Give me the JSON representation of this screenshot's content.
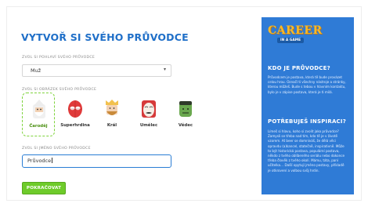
{
  "page": {
    "title": "Vytvoř si svého průvodce"
  },
  "gender": {
    "label": "ZVOL SI POHLAVÍ SVÉHO PRŮVODCE",
    "selected": "Muž"
  },
  "avatar": {
    "label": "ZVOL SI OBRÁZEK SVÉHO PRŮVODCE",
    "options": [
      {
        "name": "Čaroděj",
        "selected": true,
        "icon": "wizard-avatar",
        "color": "#e2e2e2"
      },
      {
        "name": "Superhrdina",
        "selected": false,
        "icon": "spider-hero-avatar",
        "color": "#e03a3a"
      },
      {
        "name": "Král",
        "selected": false,
        "icon": "king-avatar",
        "color": "#f2c14e"
      },
      {
        "name": "Umělec",
        "selected": false,
        "icon": "artist-mask-avatar",
        "color": "#d63a3a"
      },
      {
        "name": "Vědec",
        "selected": false,
        "icon": "hulk-scientist-avatar",
        "color": "#6aa84f"
      }
    ]
  },
  "guide_name": {
    "label": "ZVOL SI JMÉNO SVÉHO PRŮVODCE",
    "value": "Průvodce"
  },
  "continue_button": "Pokračovat",
  "sidebar": {
    "logo_main": "CAREER",
    "logo_sub": "IN A GAME",
    "section1_title": "Kdo je průvodce?",
    "section1_text": "Průvodcem je postava, která tě bude provázet celou hrou. Označí ti všechny nástroje a stránky, kterou můžeš. Bude s tebou v hlavním kontaktu, bylo je v zápise postava, která je ti milá.",
    "section2_title": "Potřebuješ inspiraci?",
    "section2_text": "Límeš si hlavu, koho si zvolit jako průvodce? Zamysli se třeba nad tím, kdo tě je v životě vzorem. Ať beer se domníváš, že dělá věci opravdu (a)kancel, statečně, inspirativně. Může to být historická postava, populární postava, někdo z tvého oblíbeného seriálu nebo dokonce třeba člověk z tvého okolí. Mámu, táta, paní učitelka… Další opytují jméno postavy, příkladě je otkrovení a volbou svůj hrdin."
  },
  "colors": {
    "accent_blue": "#1f6fc8",
    "sidebar_blue": "#2f7bd6",
    "button_green": "#6ecb2a",
    "logo_yellow": "#f7b928"
  }
}
